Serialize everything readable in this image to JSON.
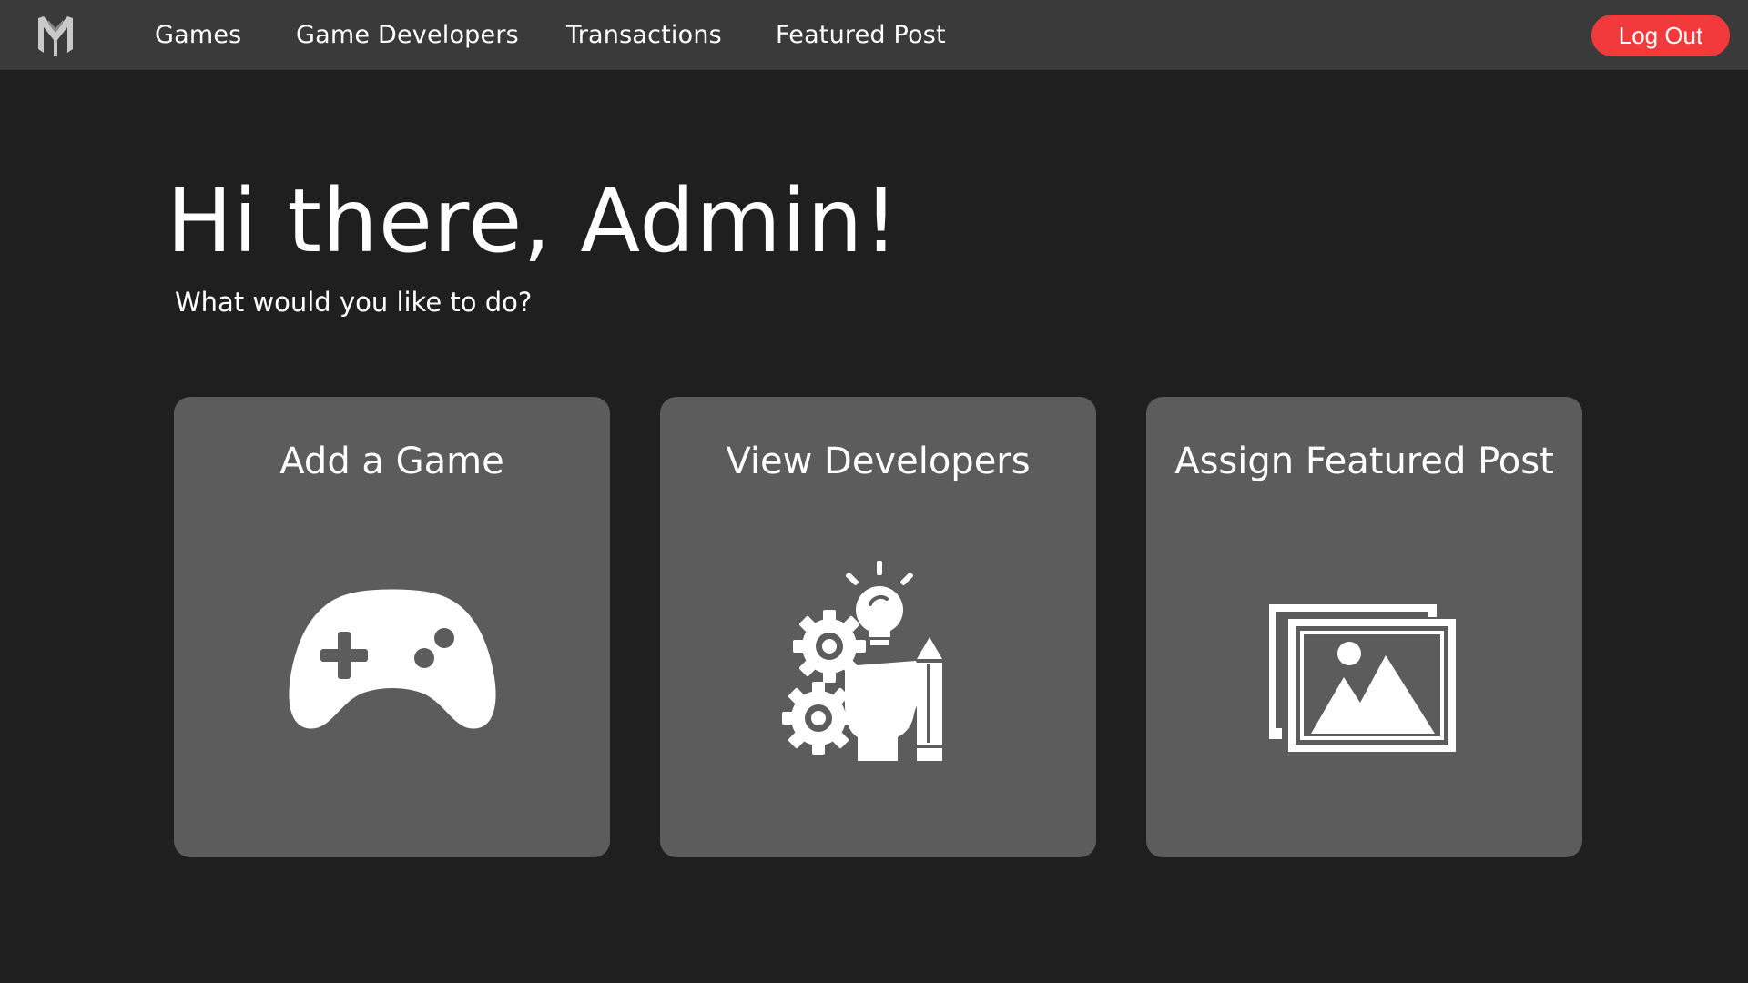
{
  "nav": {
    "logo_icon": "m-monogram-logo-icon",
    "links": [
      "Games",
      "Game Developers",
      "Transactions",
      "Featured Post"
    ],
    "logout_label": "Log Out"
  },
  "hero": {
    "greeting": "Hi there, Admin!",
    "subtitle": "What would you like to do?"
  },
  "cards": [
    {
      "title": "Add a Game",
      "icon": "game-controller-icon"
    },
    {
      "title": "View Developers",
      "icon": "developer-ideas-icon"
    },
    {
      "title": "Assign Featured Post",
      "icon": "image-gallery-icon"
    }
  ],
  "colors": {
    "page_background": "#1f1f1f",
    "navbar_background": "#3a3a3a",
    "card_background": "#5c5c5c",
    "logout_accent": "#f23a3c",
    "text": "#ffffff"
  }
}
